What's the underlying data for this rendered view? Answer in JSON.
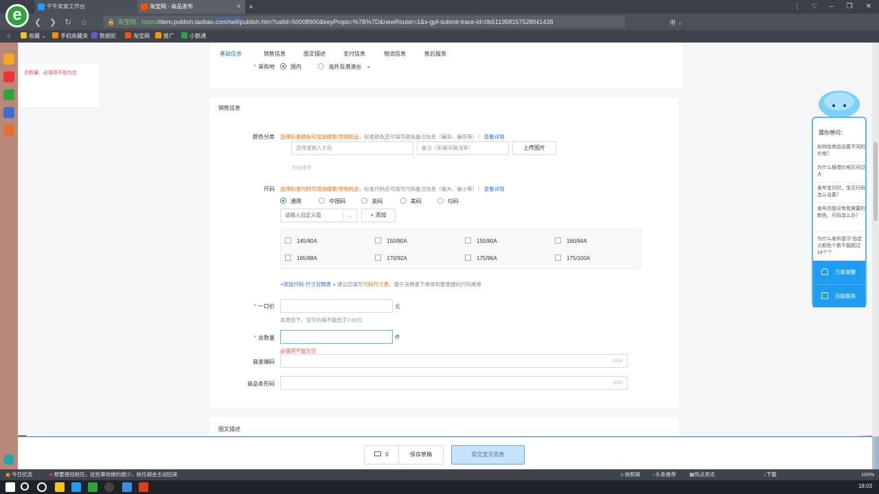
{
  "browser": {
    "tabs": [
      {
        "label": "千牛卖家工作台",
        "color": "#1f9df0"
      },
      {
        "label": "淘宝网 - 商品发布",
        "color": "#ff5000"
      }
    ],
    "url_secure": "淘宝网",
    "url_scheme": "https",
    "url_rest": "://item.publish.taobao.com/sell/publish.htm?catId=50008900&keyProps=%7B%7D&newRouter=1&x-gpf-submit-trace-id=0b511958157528041438",
    "bookmarks": [
      "收藏",
      "手机收藏夹",
      "数据蛇",
      "淘宝网",
      "推广",
      "小鹅通"
    ]
  },
  "error_panel": {
    "text": "总数量：必填项不能为空"
  },
  "subtabs": [
    "基础信息",
    "销售信息",
    "图文描述",
    "支付信息",
    "物流信息",
    "售后服务"
  ],
  "basic": {
    "label": "采购地",
    "options": [
      "国内",
      "海外及港澳台"
    ]
  },
  "sales": {
    "section_title": "销售信息",
    "color": {
      "label": "颜色分类",
      "hint_orange": "选择标准颜色可增加搜索/导购机会",
      "hint_gray": "，标准颜色还可填写颜色备注信息（偏深、偏亮等）！",
      "hint_link": "查看详情",
      "main_placeholder": "选择或输入主色",
      "note_placeholder": "备注（如偏深偏浅等）",
      "upload_label": "上传图片",
      "sort_label": "开始排序"
    },
    "size": {
      "label": "尺码",
      "hint_orange": "选择标准尺码可增加搜索/导购机会",
      "hint_gray": "，标准尺码还可填写尺码备注信息（偏大、偏小等）！",
      "hint_link": "查看详情",
      "radio_options": [
        "通用",
        "中国码",
        "英码",
        "美码",
        "均码"
      ],
      "custom_placeholder": "请输入自定义值",
      "add_label": "+ 添加",
      "items": [
        "145/80A",
        "150/80A",
        "155/80A",
        "160/84A",
        "165/88A",
        "170/92A",
        "175/96A",
        "175/100A"
      ],
      "chart_link": "+添加尺码-尺寸对照表",
      "chart_hint_pre": "建议您填写",
      "chart_hint_orange": "尺码尺寸表",
      "chart_hint_post": "，便于消费者下单得到更便捷的尺码推荐"
    },
    "price": {
      "label": "一口价",
      "unit": "元",
      "hint": "本类目下，宝贝价格不能低于7.00元"
    },
    "quantity": {
      "label": "总数量",
      "unit": "件",
      "error": "必填项不能为空"
    },
    "merchant_code": {
      "label": "商家编码",
      "counter": "0/64"
    },
    "barcode": {
      "label": "商品条形码",
      "counter": "0/32"
    }
  },
  "desc_section": {
    "title": "图文描述"
  },
  "bottom": {
    "count": "0",
    "save_draft": "保存草稿",
    "submit": "提交宝贝信息"
  },
  "helper": {
    "title": "猜你想问：",
    "questions": [
      "如何给商品设置不同的价格？",
      "为什么报错价格区间过大",
      "发布宝贝时，宝贝尺码怎么设置？",
      "发布页面没有我需要的颜色、尺码怎么办？",
      "为什么发布提示“自定义颜色个数不能超过24个”？"
    ],
    "btn1": "万象提醒",
    "btn2": "自助服务"
  },
  "status": {
    "left1": "今日优选",
    "left2": "想要挽回前任，这些事你做的越少，前任越会主动回来",
    "right": [
      "快剪辑",
      "头条推荐",
      "热点资讯",
      "下载",
      "100%"
    ]
  },
  "taskbar": {
    "time": "18:03"
  }
}
